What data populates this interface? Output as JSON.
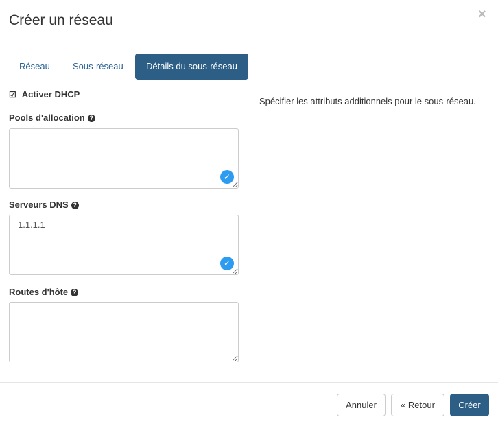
{
  "dialog": {
    "title": "Créer un réseau",
    "close": "×"
  },
  "tabs": [
    {
      "label": "Réseau"
    },
    {
      "label": "Sous-réseau"
    },
    {
      "label": "Détails du sous-réseau",
      "active": true
    }
  ],
  "form": {
    "dhcp": {
      "label": "Activer DHCP",
      "checked": true
    },
    "pools": {
      "label": "Pools d'allocation",
      "value": ""
    },
    "dns": {
      "label": "Serveurs DNS",
      "value": "1.1.1.1"
    },
    "routes": {
      "label": "Routes d'hôte",
      "value": ""
    }
  },
  "help_text": "Spécifier les attributs additionnels pour le sous-réseau.",
  "footer": {
    "cancel": "Annuler",
    "back": "« Retour",
    "create": "Créer"
  }
}
